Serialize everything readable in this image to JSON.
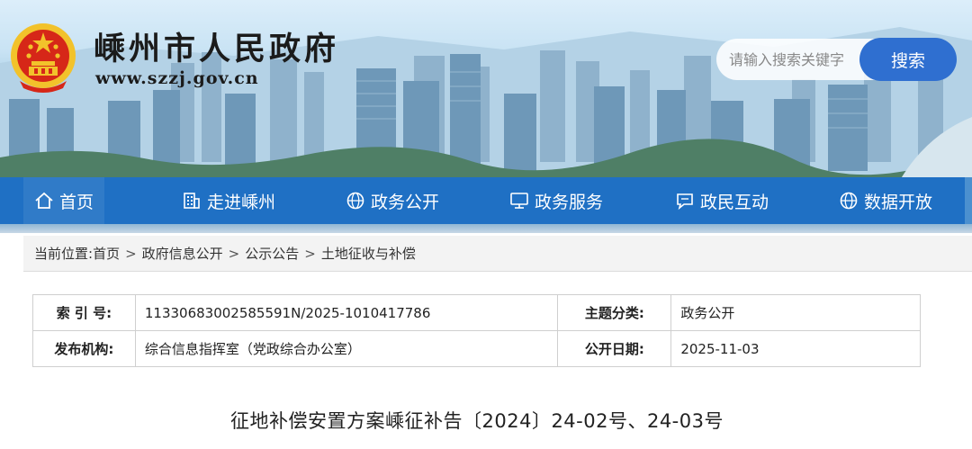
{
  "header": {
    "site_title": "嵊州市人民政府",
    "site_url": "www.szzj.gov.cn",
    "search": {
      "placeholder": "请输入搜索关键字",
      "button_label": "搜索"
    }
  },
  "nav": {
    "items": [
      {
        "label": "首页",
        "icon": "home-icon",
        "active": true
      },
      {
        "label": "走进嵊州",
        "icon": "building-icon"
      },
      {
        "label": "政务公开",
        "icon": "globe-icon"
      },
      {
        "label": "政务服务",
        "icon": "monitor-icon"
      },
      {
        "label": "政民互动",
        "icon": "chat-icon"
      },
      {
        "label": "数据开放",
        "icon": "globe-icon"
      }
    ]
  },
  "breadcrumb": {
    "prefix": "当前位置:",
    "items": [
      "首页",
      "政府信息公开",
      "公示公告",
      "土地征收与补偿"
    ],
    "separator": ">"
  },
  "info": {
    "index_label": "索 引 号:",
    "index_value": "11330683002585591N/2025-1010417786",
    "topic_label": "主题分类:",
    "topic_value": "政务公开",
    "publisher_label": "发布机构:",
    "publisher_value": "综合信息指挥室（党政综合办公室）",
    "date_label": "公开日期:",
    "date_value": "2025-11-03"
  },
  "article": {
    "title": "征地补偿安置方案嵊征补告〔2024〕24-02号、24-03号"
  },
  "colors": {
    "nav_blue": "#1f70c4",
    "search_button": "#2f6fd0",
    "emblem_red": "#d62718",
    "emblem_gold": "#f2c22b"
  }
}
